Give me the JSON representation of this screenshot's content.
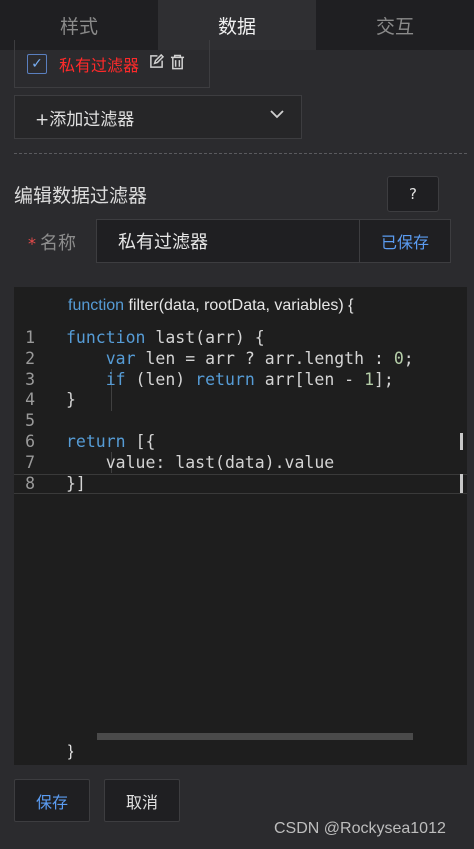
{
  "tabs": [
    {
      "label": "样式",
      "active": false
    },
    {
      "label": "数据",
      "active": true
    },
    {
      "label": "交互",
      "active": false
    }
  ],
  "filter_list": {
    "item_checked": true,
    "item_name": "私有过滤器",
    "edit_icon": "edit-icon",
    "delete_icon": "trash-icon"
  },
  "add_filter": {
    "label": "+添加过滤器",
    "icon": "chevron-down-icon"
  },
  "editor_section": {
    "title": "编辑数据过滤器",
    "help_label": "?",
    "name_label": "名称",
    "required_mark": "*",
    "name_value": "私有过滤器",
    "saved_label": "已保存"
  },
  "code_editor": {
    "header_keyword": "function",
    "header_rest": " filter(data, rootData, variables) {",
    "footer": "}",
    "lines": [
      {
        "no": "1",
        "text": "function last(arr) {"
      },
      {
        "no": "2",
        "text": "    var len = arr ? arr.length : 0;"
      },
      {
        "no": "3",
        "text": "    if (len) return arr[len - 1];"
      },
      {
        "no": "4",
        "text": "}"
      },
      {
        "no": "5",
        "text": ""
      },
      {
        "no": "6",
        "text": "return [{"
      },
      {
        "no": "7",
        "text": "    value: last(data).value"
      },
      {
        "no": "8",
        "text": "}]"
      }
    ]
  },
  "actions": {
    "save_label": "保存",
    "cancel_label": "取消"
  },
  "watermark": "CSDN @Rockysea1012",
  "colors": {
    "accent": "#5b9cf2",
    "danger": "#ff2a2a",
    "keyword": "#569cd6",
    "number": "#b5cea8"
  }
}
